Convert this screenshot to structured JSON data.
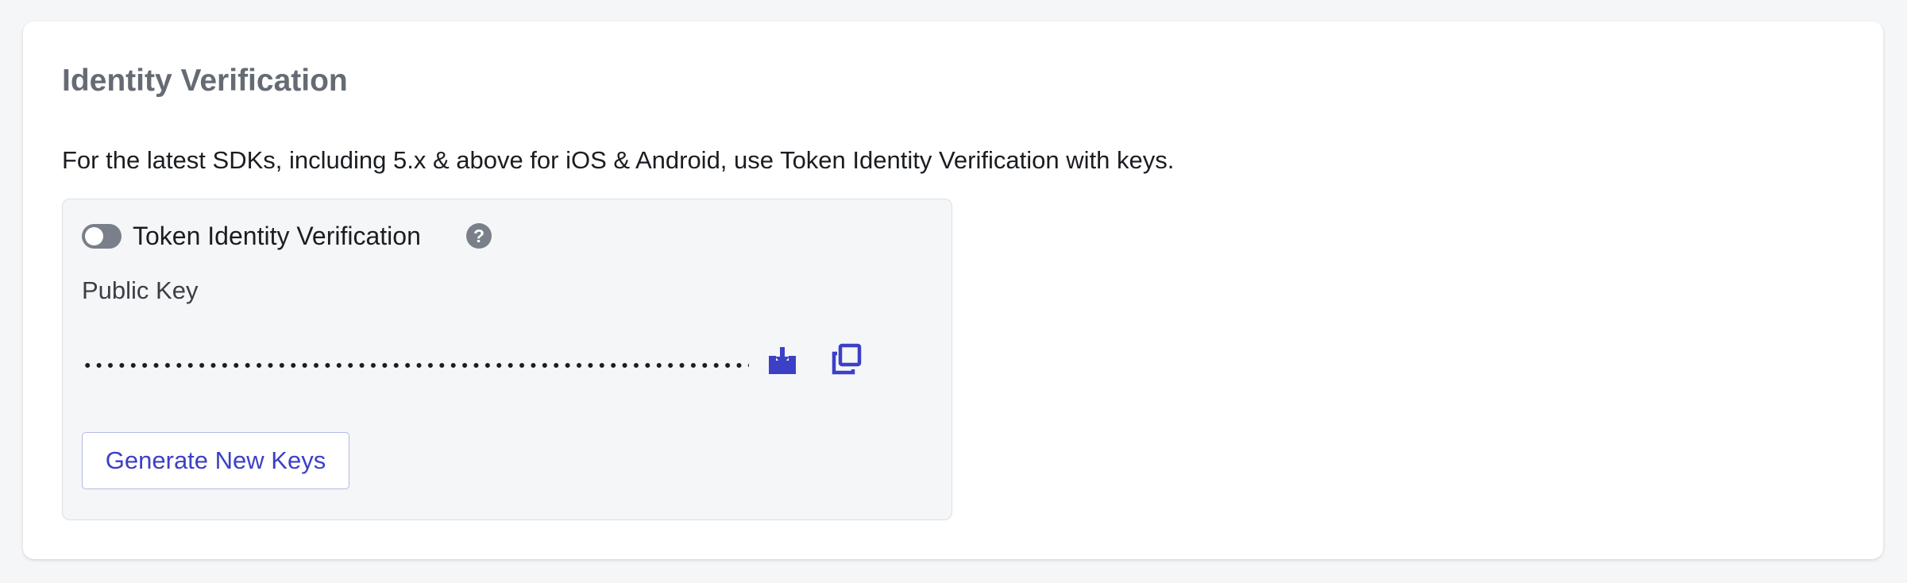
{
  "section": {
    "title": "Identity Verification",
    "description": "For the latest SDKs, including 5.x & above for iOS & Android, use Token Identity Verification with keys."
  },
  "token_verification": {
    "toggle_label": "Token Identity Verification",
    "enabled": false,
    "help_icon": "question-circle-icon",
    "help_glyph": "?"
  },
  "public_key": {
    "label": "Public Key",
    "masked": true,
    "download_icon": "download-icon",
    "copy_icon": "copy-icon"
  },
  "actions": {
    "generate_label": "Generate New Keys"
  },
  "colors": {
    "accent": "#3c40c6",
    "toggle_off": "#7a8089",
    "panel_bg": "#f5f6f8",
    "title": "#656b74"
  }
}
